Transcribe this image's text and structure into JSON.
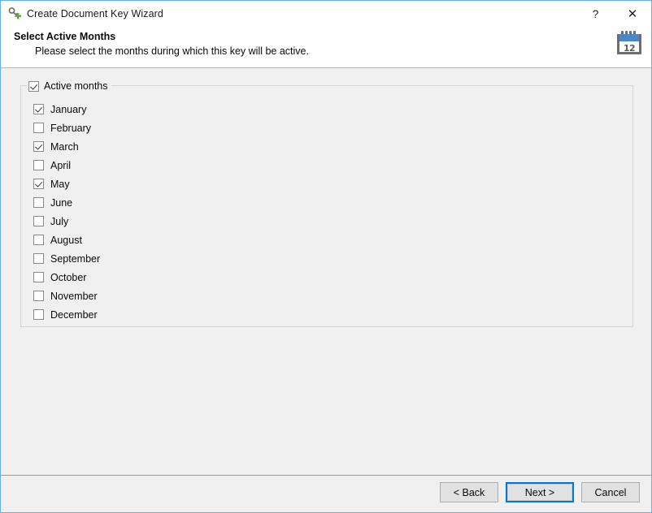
{
  "window": {
    "title": "Create Document Key Wizard",
    "title_icon": "key-add-icon",
    "help_label": "?",
    "close_label": "✕"
  },
  "header": {
    "title": "Select Active Months",
    "subtitle": "Please select the months during which this key will be active.",
    "icon": "calendar-icon",
    "icon_number": "12"
  },
  "groupbox": {
    "label": "Active months",
    "checked": true,
    "months": [
      {
        "label": "January",
        "checked": true
      },
      {
        "label": "February",
        "checked": false
      },
      {
        "label": "March",
        "checked": true
      },
      {
        "label": "April",
        "checked": false
      },
      {
        "label": "May",
        "checked": true
      },
      {
        "label": "June",
        "checked": false
      },
      {
        "label": "July",
        "checked": false
      },
      {
        "label": "August",
        "checked": false
      },
      {
        "label": "September",
        "checked": false
      },
      {
        "label": "October",
        "checked": false
      },
      {
        "label": "November",
        "checked": false
      },
      {
        "label": "December",
        "checked": false
      }
    ]
  },
  "footer": {
    "back_label": "< Back",
    "next_label": "Next >",
    "cancel_label": "Cancel"
  },
  "colors": {
    "window_border": "#69b0e8",
    "accent": "#0078d7",
    "body_bg": "#f0f0f0",
    "calendar_band": "#4a86c8"
  }
}
